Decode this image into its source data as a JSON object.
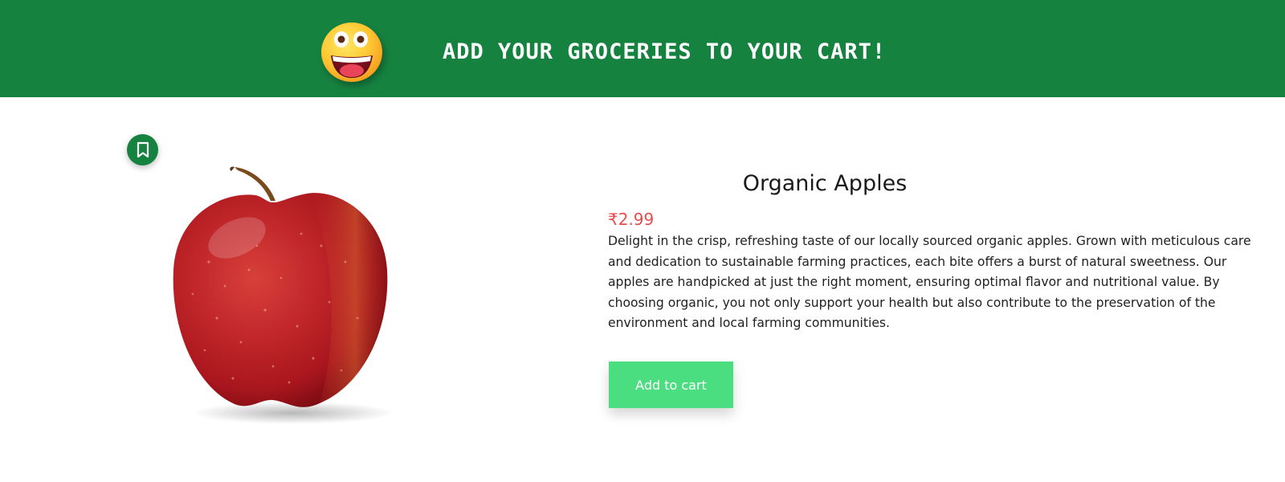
{
  "header": {
    "title": "ADD YOUR GROCERIES TO YOUR CART!",
    "emoji_icon": "grinning-face-emoji-icon",
    "background_color": "#168240"
  },
  "product": {
    "bookmark_icon": "bookmark-icon",
    "image_icon": "red-apple-image",
    "name": "Organic Apples",
    "price": "₹2.99",
    "description": "Delight in the crisp, refreshing taste of our locally sourced organic apples. Grown with meticulous care and dedication to sustainable farming practices, each bite offers a burst of natural sweetness. Our apples are handpicked at just the right moment, ensuring optimal flavor and nutritional value. By choosing organic, you not only support your health but also contribute to the preservation of the environment and local farming communities.",
    "add_to_cart_label": "Add to cart"
  },
  "colors": {
    "brand_green": "#168240",
    "price_red": "#e84c4c",
    "cart_button_green": "#4ade80"
  }
}
